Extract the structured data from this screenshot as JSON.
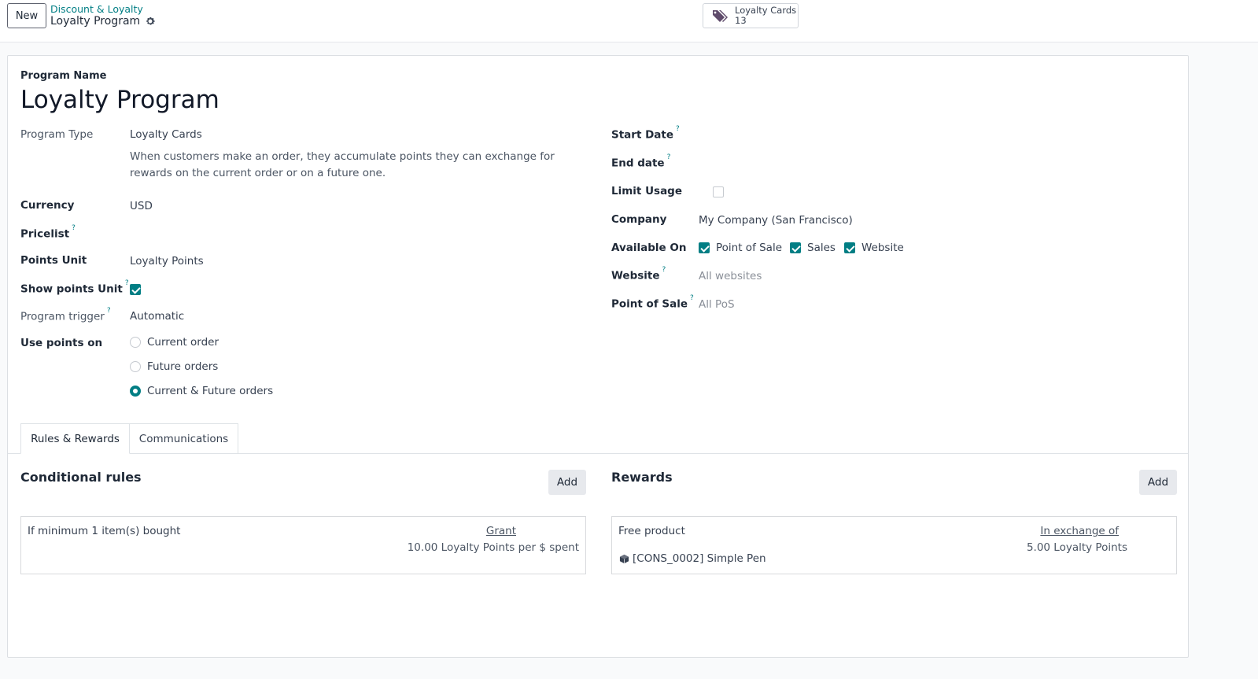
{
  "header": {
    "new_label": "New",
    "breadcrumb_parent": "Discount & Loyalty",
    "breadcrumb_current": "Loyalty Program",
    "smart_button": {
      "label": "Loyalty Cards",
      "count": "13",
      "icon": "tags-icon"
    }
  },
  "form": {
    "program_name_label": "Program Name",
    "program_name": "Loyalty Program",
    "left": {
      "program_type": {
        "label": "Program Type",
        "value": "Loyalty Cards",
        "description": "When customers make an order, they accumulate points they can exchange for rewards on the current order or on a future one."
      },
      "currency": {
        "label": "Currency",
        "value": "USD"
      },
      "pricelist": {
        "label": "Pricelist",
        "help": "?",
        "value": ""
      },
      "points_unit": {
        "label": "Points Unit",
        "value": "Loyalty Points"
      },
      "show_points_unit": {
        "label": "Show points Unit",
        "help": "?",
        "checked": true
      },
      "program_trigger": {
        "label": "Program trigger",
        "help": "?",
        "value": "Automatic"
      },
      "use_points_on": {
        "label": "Use points on",
        "options": [
          {
            "label": "Current order",
            "selected": false
          },
          {
            "label": "Future orders",
            "selected": false
          },
          {
            "label": "Current & Future orders",
            "selected": true
          }
        ]
      }
    },
    "right": {
      "start_date": {
        "label": "Start Date",
        "help": "?",
        "value": ""
      },
      "end_date": {
        "label": "End date",
        "help": "?",
        "value": ""
      },
      "limit_usage": {
        "label": "Limit Usage",
        "checked": false
      },
      "company": {
        "label": "Company",
        "value": "My Company (San Francisco)"
      },
      "available_on": {
        "label": "Available On",
        "options": [
          {
            "label": "Point of Sale",
            "checked": true
          },
          {
            "label": "Sales",
            "checked": true
          },
          {
            "label": "Website",
            "checked": true
          }
        ]
      },
      "website": {
        "label": "Website",
        "help": "?",
        "placeholder": "All websites"
      },
      "point_of_sale": {
        "label": "Point of Sale",
        "help": "?",
        "placeholder": "All PoS"
      }
    }
  },
  "tabs": [
    {
      "label": "Rules & Rewards",
      "active": true
    },
    {
      "label": "Communications",
      "active": false
    }
  ],
  "rules": {
    "title": "Conditional rules",
    "add_label": "Add",
    "items": [
      {
        "condition": "If minimum 1 item(s) bought",
        "grant_label": "Grant",
        "grant_value": "10.00 Loyalty Points per $ spent"
      }
    ]
  },
  "rewards": {
    "title": "Rewards",
    "add_label": "Add",
    "items": [
      {
        "type": "Free product",
        "product": "[CONS_0002] Simple Pen",
        "exchange_label": "In exchange of",
        "exchange_value": "5.00 Loyalty Points"
      }
    ]
  },
  "colors": {
    "accent": "#017e84",
    "link": "#017e84"
  }
}
